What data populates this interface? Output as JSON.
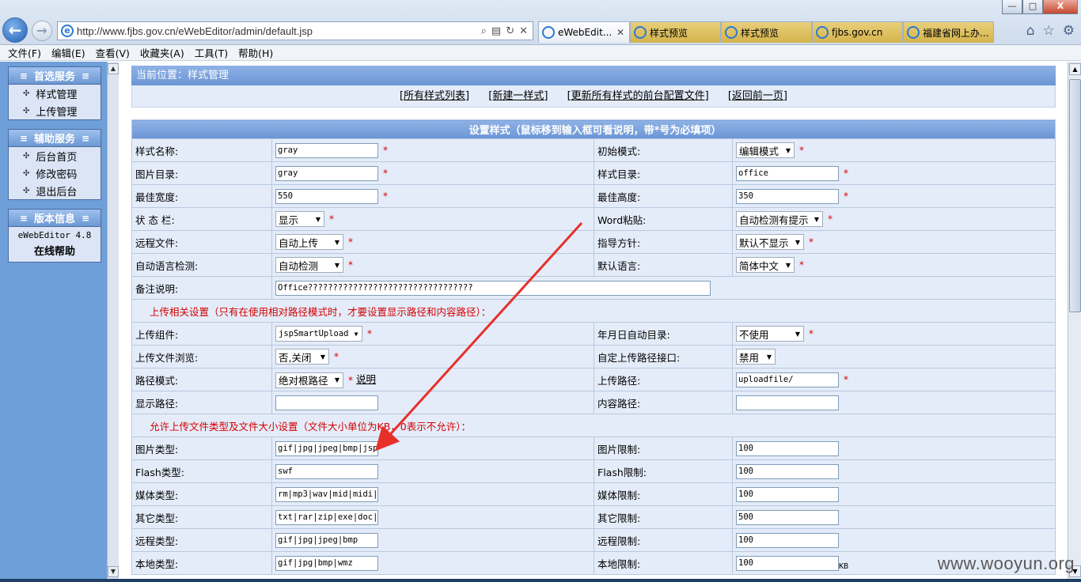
{
  "browser": {
    "url": "http://www.fjbs.gov.cn/eWebEditor/admin/default.jsp",
    "tabs": [
      {
        "label": "eWebEdit...",
        "active": true
      },
      {
        "label": "样式预览",
        "active": false
      },
      {
        "label": "样式预览",
        "active": false
      },
      {
        "label": "fjbs.gov.cn",
        "active": false
      },
      {
        "label": "福建省网上办...",
        "active": false
      }
    ],
    "window_controls": {
      "minimize": "—",
      "maximize": "□",
      "close": "X"
    },
    "menu": [
      "文件(F)",
      "编辑(E)",
      "查看(V)",
      "收藏夹(A)",
      "工具(T)",
      "帮助(H)"
    ]
  },
  "sidebar": {
    "section1": {
      "title": "首选服务",
      "items": [
        "样式管理",
        "上传管理"
      ]
    },
    "section2": {
      "title": "辅助服务",
      "items": [
        "后台首页",
        "修改密码",
        "退出后台"
      ]
    },
    "section3": {
      "title": "版本信息",
      "version": "eWebEditor 4.8",
      "help": "在线帮助"
    }
  },
  "main": {
    "breadcrumb": "当前位置：样式管理",
    "links": [
      "[所有样式列表]",
      "[新建一样式]",
      "[更新所有样式的前台配置文件]",
      "[返回前一页]"
    ],
    "form_title": "设置样式（鼠标移到输入框可看说明，带*号为必填项）",
    "required_mark": "*",
    "fields": {
      "style_name": {
        "label": "样式名称:",
        "value": "gray"
      },
      "init_mode": {
        "label": "初始模式:",
        "value": "编辑模式"
      },
      "image_dir": {
        "label": "图片目录:",
        "value": "gray"
      },
      "style_dir": {
        "label": "样式目录:",
        "value": "office"
      },
      "best_width": {
        "label": "最佳宽度:",
        "value": "550"
      },
      "best_height": {
        "label": "最佳高度:",
        "value": "350"
      },
      "status_bar": {
        "label": "状 态 栏:",
        "value": "显示"
      },
      "word_paste": {
        "label": "Word粘贴:",
        "value": "自动检测有提示"
      },
      "remote_file": {
        "label": "远程文件:",
        "value": "自动上传"
      },
      "guide": {
        "label": "指导方针:",
        "value": "默认不显示"
      },
      "auto_lang": {
        "label": "自动语言检测:",
        "value": "自动检测"
      },
      "default_lang": {
        "label": "默认语言:",
        "value": "简体中文"
      },
      "remark": {
        "label": "备注说明:",
        "value": "Office?????????????????????????????????"
      }
    },
    "upload_section_title": "上传相关设置（只有在使用相对路径模式时，才要设置显示路径和内容路径）：",
    "upload_fields": {
      "component": {
        "label": "上传组件:",
        "value": "jspSmartUpload"
      },
      "date_dir": {
        "label": "年月日自动目录:",
        "value": "不使用"
      },
      "browse": {
        "label": "上传文件浏览:",
        "value": "否,关闭"
      },
      "custom_path": {
        "label": "自定上传路径接口:",
        "value": "禁用"
      },
      "path_mode": {
        "label": "路径模式:",
        "value": "绝对根路径",
        "help": "说明"
      },
      "upload_path": {
        "label": "上传路径:",
        "value": "uploadfile/"
      },
      "display_path": {
        "label": "显示路径:",
        "value": ""
      },
      "content_path": {
        "label": "内容路径:",
        "value": ""
      }
    },
    "types_section_title": "允许上传文件类型及文件大小设置（文件大小单位为KB，0表示不允许）：",
    "type_rows": [
      {
        "label": "图片类型:",
        "value": "gif|jpg|jpeg|bmp|jsp",
        "limit_label": "图片限制:",
        "limit": "100"
      },
      {
        "label": "Flash类型:",
        "value": "swf",
        "limit_label": "Flash限制:",
        "limit": "100"
      },
      {
        "label": "媒体类型:",
        "value": "rm|mp3|wav|mid|midi|r",
        "limit_label": "媒体限制:",
        "limit": "100"
      },
      {
        "label": "其它类型:",
        "value": "txt|rar|zip|exe|doc|d",
        "limit_label": "其它限制:",
        "limit": "500"
      },
      {
        "label": "远程类型:",
        "value": "gif|jpg|jpeg|bmp",
        "limit_label": "远程限制:",
        "limit": "100"
      },
      {
        "label": "本地类型:",
        "value": "gif|jpg|bmp|wmz",
        "limit_label": "本地限制:",
        "limit": "100"
      }
    ],
    "unit_kb": "KB"
  },
  "watermark": "www.wooyun.org",
  "colors": {
    "header_blue": "#6a95d4",
    "row_bg": "#e4ecf9",
    "required_red": "#d40000",
    "annotation_arrow": "#e8302a"
  }
}
